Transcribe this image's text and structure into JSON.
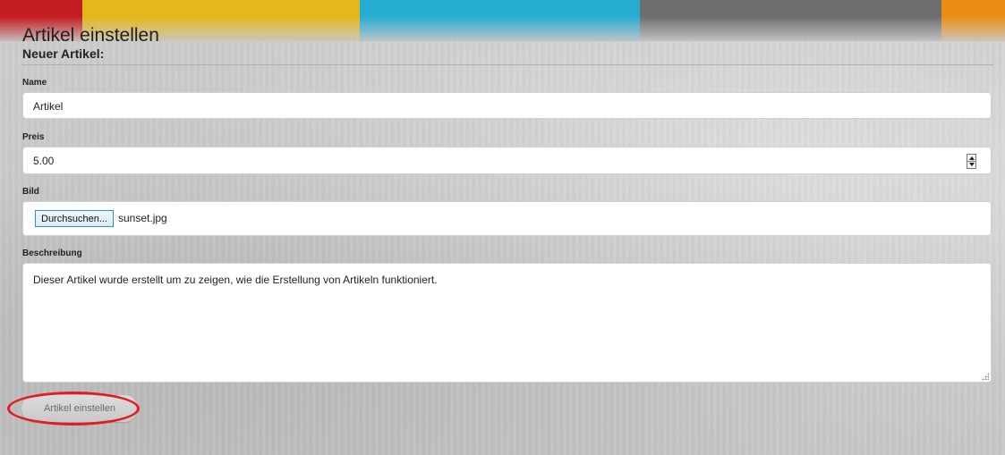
{
  "colors": {
    "banner_segments": [
      "#b81f24",
      "#e0b82a",
      "#31aacb",
      "#6e6e6e",
      "#e3901f"
    ],
    "highlight_ring": "#e31b23",
    "file_button_border": "#2f8fd6"
  },
  "page": {
    "title": "Artikel einstellen",
    "subtitle": "Neuer Artikel:"
  },
  "form": {
    "name": {
      "label": "Name",
      "value": "Artikel"
    },
    "price": {
      "label": "Preis",
      "value": "5.00"
    },
    "image": {
      "label": "Bild",
      "button_label": "Durchsuchen...",
      "file_name": "sunset.jpg"
    },
    "description": {
      "label": "Beschreibung",
      "value": "Dieser Artikel wurde erstellt um zu zeigen, wie die Erstellung von Artikeln funktioniert."
    },
    "submit_label": "Artikel einstellen"
  },
  "icons": [
    "spinner-up-icon",
    "spinner-down-icon",
    "resize-grip-icon"
  ]
}
